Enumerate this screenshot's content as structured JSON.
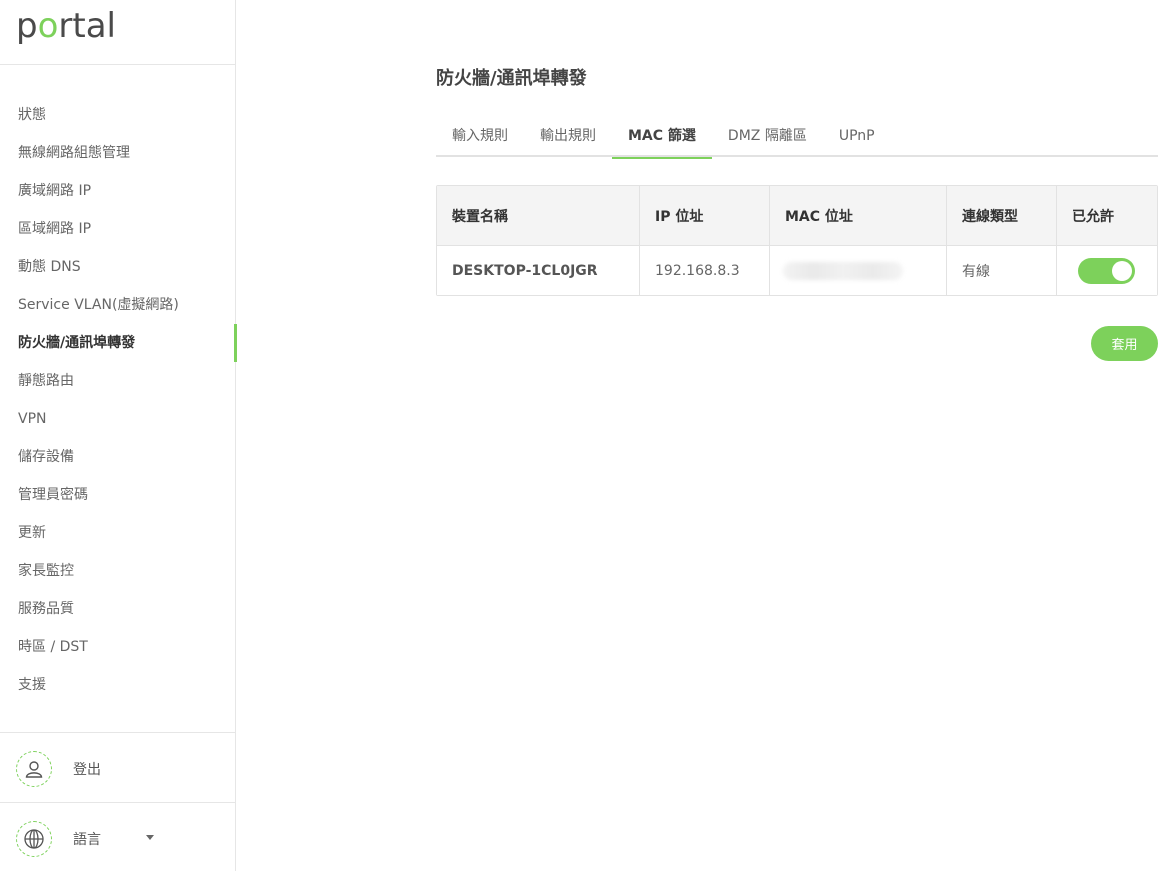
{
  "brand": {
    "logo_prefix": "p",
    "logo_o": "o",
    "logo_suffix": "rtal",
    "accent_color": "#7dd15b"
  },
  "sidebar": {
    "items": [
      {
        "label": "狀態"
      },
      {
        "label": "無線網路組態管理"
      },
      {
        "label": "廣域網路 IP"
      },
      {
        "label": "區域網路 IP"
      },
      {
        "label": "動態 DNS"
      },
      {
        "label": "Service VLAN(虛擬網路)"
      },
      {
        "label": "防火牆/通訊埠轉發",
        "active": true
      },
      {
        "label": "靜態路由"
      },
      {
        "label": "VPN"
      },
      {
        "label": "儲存設備"
      },
      {
        "label": "管理員密碼"
      },
      {
        "label": "更新"
      },
      {
        "label": "家長監控"
      },
      {
        "label": "服務品質"
      },
      {
        "label": "時區 / DST"
      },
      {
        "label": "支援"
      }
    ],
    "logout_label": "登出",
    "language_label": "語言",
    "icons": {
      "logout": "user-icon",
      "language": "globe-icon",
      "dropdown": "caret-down-icon"
    }
  },
  "main": {
    "title": "防火牆/通訊埠轉發",
    "tabs": [
      {
        "label": "輸入規則"
      },
      {
        "label": "輸出規則"
      },
      {
        "label": "MAC 篩選",
        "active": true
      },
      {
        "label": "DMZ 隔離區"
      },
      {
        "label": "UPnP"
      }
    ],
    "table": {
      "headers": [
        "裝置名稱",
        "IP 位址",
        "MAC 位址",
        "連線類型",
        "已允許"
      ],
      "rows": [
        {
          "device_name": "DESKTOP-1CL0JGR",
          "ip": "192.168.8.3",
          "mac": "",
          "connection_type": "有線",
          "allowed": true
        }
      ]
    },
    "apply_label": "套用"
  }
}
